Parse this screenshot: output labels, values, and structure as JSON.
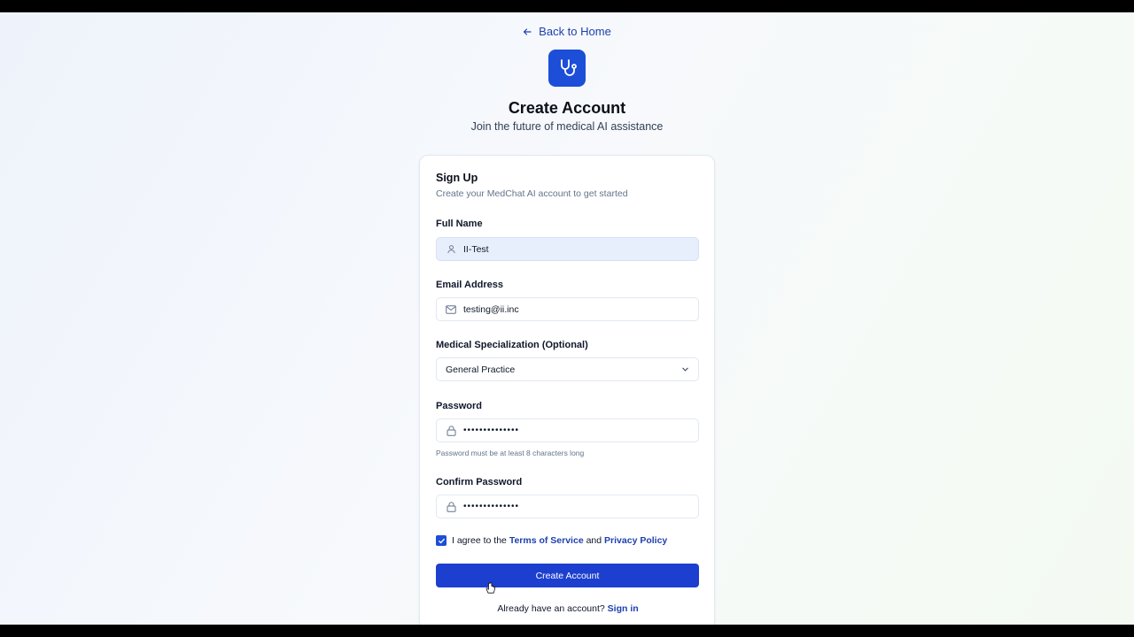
{
  "nav": {
    "back_label": "Back to Home"
  },
  "header": {
    "title": "Create Account",
    "subtitle": "Join the future of medical AI assistance"
  },
  "form": {
    "title": "Sign Up",
    "description": "Create your MedChat AI account to get started",
    "full_name": {
      "label": "Full Name",
      "value": "II-Test",
      "icon": "user-icon"
    },
    "email": {
      "label": "Email Address",
      "value": "testing@ii.inc",
      "icon": "mail-icon"
    },
    "specialization": {
      "label": "Medical Specialization (Optional)",
      "value": "General Practice"
    },
    "password": {
      "label": "Password",
      "value": "••••••••••••••",
      "hint": "Password must be at least 8 characters long",
      "icon": "lock-icon"
    },
    "confirm_password": {
      "label": "Confirm Password",
      "value": "••••••••••••••",
      "icon": "lock-icon"
    },
    "agree": {
      "checked": true,
      "prefix": "I agree to the",
      "terms": "Terms of Service",
      "and": "and",
      "privacy": "Privacy Policy"
    },
    "submit_label": "Create Account",
    "signin_prompt": "Already have an account?",
    "signin_link": "Sign in"
  },
  "colors": {
    "accent": "#1d4ed8",
    "button": "#1d3fcf",
    "link": "#1e40af"
  }
}
